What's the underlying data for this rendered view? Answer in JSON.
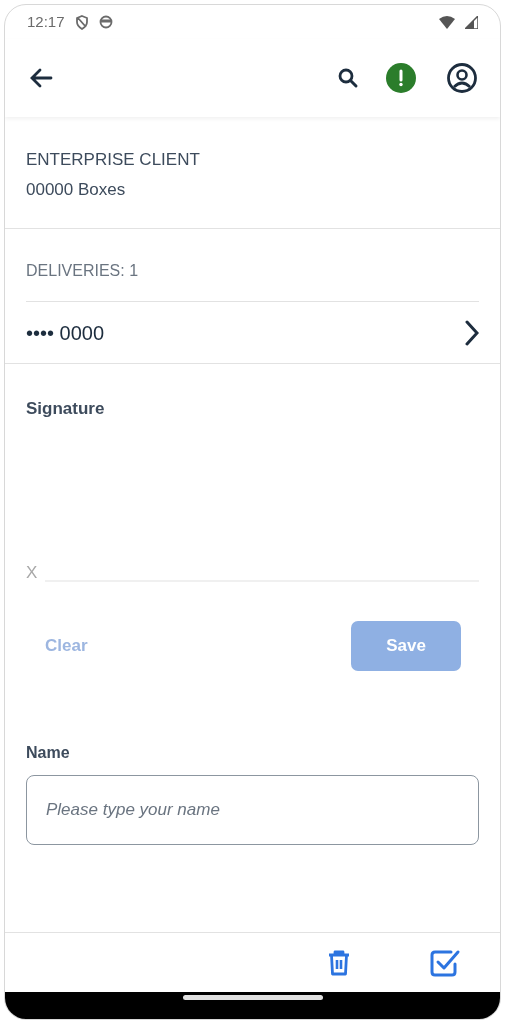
{
  "status_bar": {
    "time": "12:17"
  },
  "client": {
    "title": "ENTERPRISE CLIENT",
    "subtitle": "00000 Boxes"
  },
  "deliveries": {
    "heading": "DELIVERIES: 1",
    "items": [
      {
        "label": "•••• 0000"
      }
    ]
  },
  "signature": {
    "label": "Signature",
    "mark": "X",
    "clear": {
      "label": "Clear",
      "disabled": true
    },
    "save": {
      "label": "Save",
      "disabled": true
    }
  },
  "name_field": {
    "label": "Name",
    "placeholder": "Please type your name"
  }
}
